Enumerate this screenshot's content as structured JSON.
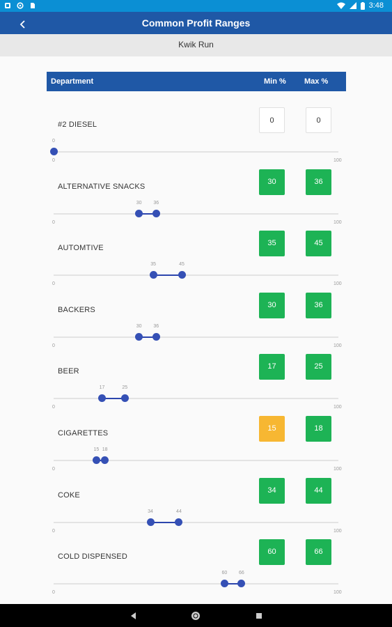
{
  "status_bar": {
    "time": "3:48",
    "left_icons": [
      "notification-icon",
      "sync-icon",
      "sim-icon"
    ],
    "right_icons": [
      "wifi-icon",
      "signal-icon",
      "battery-icon"
    ]
  },
  "app_bar": {
    "title": "Common Profit Ranges",
    "back_icon": "back-icon"
  },
  "store_name": "Kwik Run",
  "table": {
    "col_department": "Department",
    "col_min": "Min %",
    "col_max": "Max %"
  },
  "colors": {
    "status_bar": "#0b8fd4",
    "app_bar": "#1f58a6",
    "green": "#1db355",
    "orange": "#f7b732",
    "slider": "#3550b5"
  },
  "rows": [
    {
      "department": "#2 DIESEL",
      "min": "0",
      "max": "0",
      "min_status": "none",
      "max_status": "none",
      "slider_min": 0,
      "slider_max": 100,
      "low": 0,
      "high": 0,
      "low_label": "0",
      "high_label": "",
      "tick_min": "0",
      "tick_max": "100"
    },
    {
      "department": "ALTERNATIVE SNACKS",
      "min": "30",
      "max": "36",
      "min_status": "good",
      "max_status": "good",
      "slider_min": 0,
      "slider_max": 100,
      "low": 30,
      "high": 36,
      "low_label": "30",
      "high_label": "36",
      "tick_min": "0",
      "tick_max": "100"
    },
    {
      "department": "AUTOMTIVE",
      "min": "35",
      "max": "45",
      "min_status": "good",
      "max_status": "good",
      "slider_min": 0,
      "slider_max": 100,
      "low": 35,
      "high": 45,
      "low_label": "35",
      "high_label": "45",
      "tick_min": "0",
      "tick_max": "100"
    },
    {
      "department": "BACKERS",
      "min": "30",
      "max": "36",
      "min_status": "good",
      "max_status": "good",
      "slider_min": 0,
      "slider_max": 100,
      "low": 30,
      "high": 36,
      "low_label": "30",
      "high_label": "36",
      "tick_min": "0",
      "tick_max": "100"
    },
    {
      "department": "BEER",
      "min": "17",
      "max": "25",
      "min_status": "good",
      "max_status": "good",
      "slider_min": 0,
      "slider_max": 100,
      "low": 17,
      "high": 25,
      "low_label": "17",
      "high_label": "25",
      "tick_min": "0",
      "tick_max": "100"
    },
    {
      "department": "CIGARETTES",
      "min": "15",
      "max": "18",
      "min_status": "warn",
      "max_status": "good",
      "slider_min": 0,
      "slider_max": 100,
      "low": 15,
      "high": 18,
      "low_label": "15",
      "high_label": "18",
      "tick_min": "0",
      "tick_max": "100"
    },
    {
      "department": "COKE",
      "min": "34",
      "max": "44",
      "min_status": "good",
      "max_status": "good",
      "slider_min": 0,
      "slider_max": 100,
      "low": 34,
      "high": 44,
      "low_label": "34",
      "high_label": "44",
      "tick_min": "0",
      "tick_max": "100"
    },
    {
      "department": "COLD DISPENSED",
      "min": "60",
      "max": "66",
      "min_status": "good",
      "max_status": "good",
      "slider_min": 0,
      "slider_max": 100,
      "low": 60,
      "high": 66,
      "low_label": "60",
      "high_label": "66",
      "tick_min": "0",
      "tick_max": "100"
    }
  ],
  "nav_bar": {
    "buttons": [
      "back-triangle-icon",
      "home-circle-icon",
      "recents-square-icon"
    ]
  }
}
